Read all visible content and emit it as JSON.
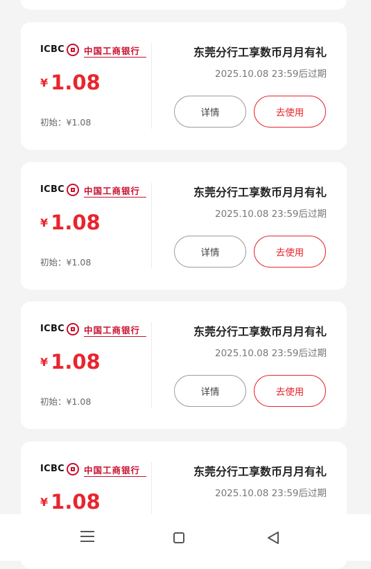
{
  "coupons": [
    {
      "brand_short": "ICBC",
      "bank_name": "中国工商银行",
      "currency": "¥",
      "amount": "1.08",
      "initial": "初始：¥1.08",
      "title": "东莞分行工享数币月月有礼",
      "expiry": "2025.10.08 23:59后过期",
      "detail_label": "详情",
      "use_label": "去使用"
    },
    {
      "brand_short": "ICBC",
      "bank_name": "中国工商银行",
      "currency": "¥",
      "amount": "1.08",
      "initial": "初始：¥1.08",
      "title": "东莞分行工享数币月月有礼",
      "expiry": "2025.10.08 23:59后过期",
      "detail_label": "详情",
      "use_label": "去使用"
    },
    {
      "brand_short": "ICBC",
      "bank_name": "中国工商银行",
      "currency": "¥",
      "amount": "1.08",
      "initial": "初始：¥1.08",
      "title": "东莞分行工享数币月月有礼",
      "expiry": "2025.10.08 23:59后过期",
      "detail_label": "详情",
      "use_label": "去使用"
    },
    {
      "brand_short": "ICBC",
      "bank_name": "中国工商银行",
      "currency": "¥",
      "amount": "1.08",
      "title": "东莞分行工享数币月月有礼",
      "expiry": "2025.10.08 23:59后过期"
    }
  ],
  "colors": {
    "accent": "#e8252e",
    "brand": "#c8102e",
    "page_bg": "#f4f4f4",
    "card_bg": "#ffffff"
  },
  "navbar": {
    "icons": [
      "menu-icon",
      "home-square-icon",
      "back-triangle-icon"
    ]
  }
}
